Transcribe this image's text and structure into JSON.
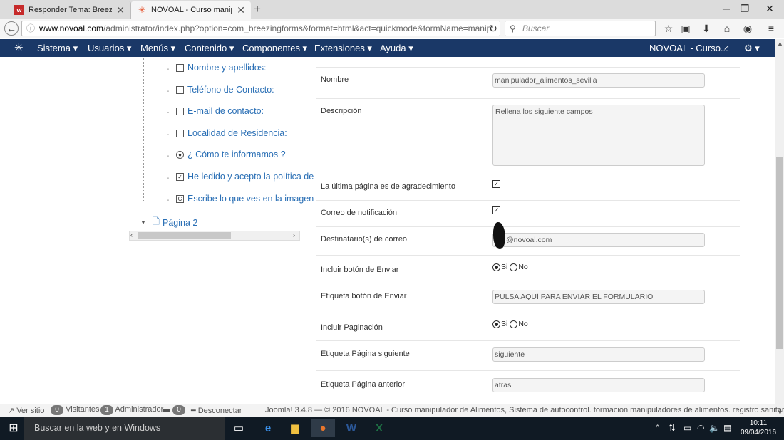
{
  "browser": {
    "tabs": [
      {
        "label": "Responder Tema: Breezin...",
        "favicon": "w-icon",
        "active": false
      },
      {
        "label": "NOVOAL - Curso manipul...",
        "favicon": "joomla-icon",
        "active": true
      }
    ],
    "new_tab": "+",
    "url_domain": "www.novoal.com",
    "url_path": "/administrator/index.php?option=com_breezingforms&format=html&act=quickmode&formName=manip",
    "search_placeholder": "Buscar"
  },
  "joomla_menu": {
    "items": [
      "Sistema ▾",
      "Usuarios ▾",
      "Menús ▾",
      "Contenido ▾",
      "Componentes ▾",
      "Extensiones ▾",
      "Ayuda ▾"
    ],
    "site_name": "NOVOAL - Curso...",
    "settings": "⚙ ▾"
  },
  "tree": {
    "items": [
      {
        "label": "Nombre y apellidos:",
        "icon": "I"
      },
      {
        "label": "Teléfono de Contacto:",
        "icon": "I"
      },
      {
        "label": "E-mail de contacto:",
        "icon": "I"
      },
      {
        "label": "Localidad de Residencia:",
        "icon": "I"
      },
      {
        "label": "¿ Cómo te informamos ?",
        "icon": "●"
      },
      {
        "label": "He ledido y acepto la política de",
        "icon": "✓"
      },
      {
        "label": "Escribe lo que ves en la imagen",
        "icon": "C"
      }
    ],
    "page2": "Página 2"
  },
  "form": {
    "nombre_label": "Nombre",
    "nombre_value": "manipulador_alimentos_sevilla",
    "descripcion_label": "Descripción",
    "descripcion_value": "Rellena los siguiente campos",
    "ultima_label": "La última página es de agradecimiento",
    "correo_label": "Correo de notificación",
    "destinatario_label": "Destinatario(s) de correo",
    "destinatario_value": "@novoal.com",
    "incluir_enviar_label": "Incluir botón de Enviar",
    "si": "Si",
    "no": "No",
    "etiqueta_enviar_label": "Etiqueta botón de Enviar",
    "etiqueta_enviar_value": "PULSA AQUÍ PARA ENVIAR EL FORMULARIO",
    "incluir_paginacion_label": "Incluir Paginación",
    "siguiente_label": "Etiqueta Página siguiente",
    "siguiente_value": "siguiente",
    "anterior_label": "Etiqueta Página anterior",
    "anterior_value": "atras"
  },
  "footer": {
    "ver_sitio": "Ver sitio",
    "visitantes_count": "0",
    "visitantes": "Visitantes",
    "admin_count": "1",
    "administrador": "Administrador",
    "msg_count": "0",
    "desconectar": "Desconectar",
    "copyright": "Joomla! 3.4.8 — © 2016 NOVOAL - Curso manipulador de Alimentos, Sistema de autocontrol. formacion manipuladores de alimentos. registro sanitario. sevilla"
  },
  "taskbar": {
    "search_placeholder": "Buscar en la web y en Windows",
    "time": "10:11",
    "date": "09/04/2016"
  },
  "colors": {
    "joomla_bar": "#1a3867",
    "link": "#2a6fb5",
    "taskbar": "#101a24"
  }
}
